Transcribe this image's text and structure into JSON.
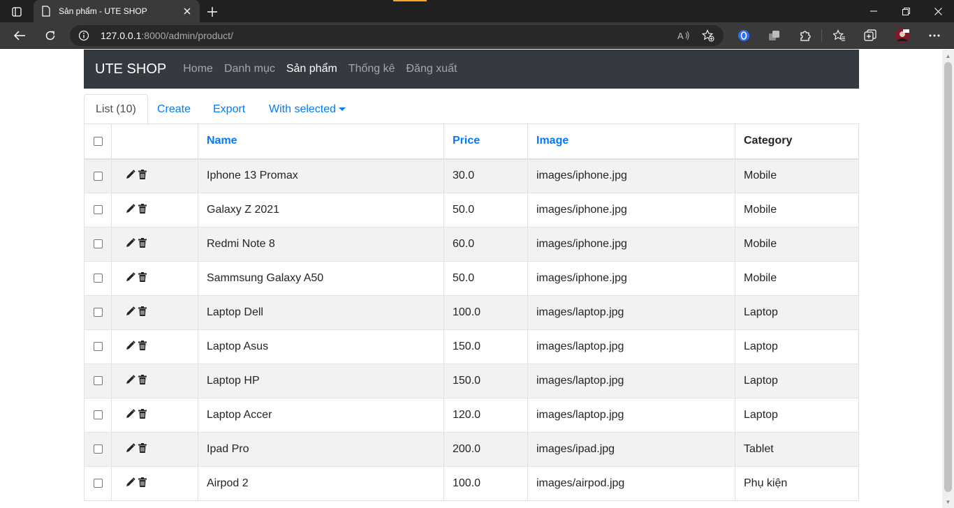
{
  "browser": {
    "tab_title": "Sản phẩm - UTE SHOP",
    "url_host": "127.0.0.1",
    "url_path": ":8000/admin/product/"
  },
  "navbar": {
    "brand": "UTE SHOP",
    "links": [
      "Home",
      "Danh mục",
      "Sản phẩm",
      "Thống kê",
      "Đăng xuất"
    ],
    "active_index": 2
  },
  "tabs": {
    "list": "List (10)",
    "create": "Create",
    "export": "Export",
    "with_selected": "With selected"
  },
  "table": {
    "headers": {
      "name": "Name",
      "price": "Price",
      "image": "Image",
      "category": "Category"
    },
    "rows": [
      {
        "name": "Iphone 13 Promax",
        "price": "30.0",
        "image": "images/iphone.jpg",
        "category": "Mobile"
      },
      {
        "name": "Galaxy Z 2021",
        "price": "50.0",
        "image": "images/iphone.jpg",
        "category": "Mobile"
      },
      {
        "name": "Redmi Note 8",
        "price": "60.0",
        "image": "images/iphone.jpg",
        "category": "Mobile"
      },
      {
        "name": "Sammsung Galaxy A50",
        "price": "50.0",
        "image": "images/iphone.jpg",
        "category": "Mobile"
      },
      {
        "name": "Laptop Dell",
        "price": "100.0",
        "image": "images/laptop.jpg",
        "category": "Laptop"
      },
      {
        "name": "Laptop Asus",
        "price": "150.0",
        "image": "images/laptop.jpg",
        "category": "Laptop"
      },
      {
        "name": "Laptop HP",
        "price": "150.0",
        "image": "images/laptop.jpg",
        "category": "Laptop"
      },
      {
        "name": "Laptop Accer",
        "price": "120.0",
        "image": "images/laptop.jpg",
        "category": "Laptop"
      },
      {
        "name": "Ipad Pro",
        "price": "200.0",
        "image": "images/ipad.jpg",
        "category": "Tablet"
      },
      {
        "name": "Airpod 2",
        "price": "100.0",
        "image": "images/airpod.jpg",
        "category": "Phụ kiện"
      }
    ]
  },
  "colors": {
    "navbar_bg": "#343a40",
    "link": "#007bff",
    "stripe": "#f2f2f2"
  }
}
